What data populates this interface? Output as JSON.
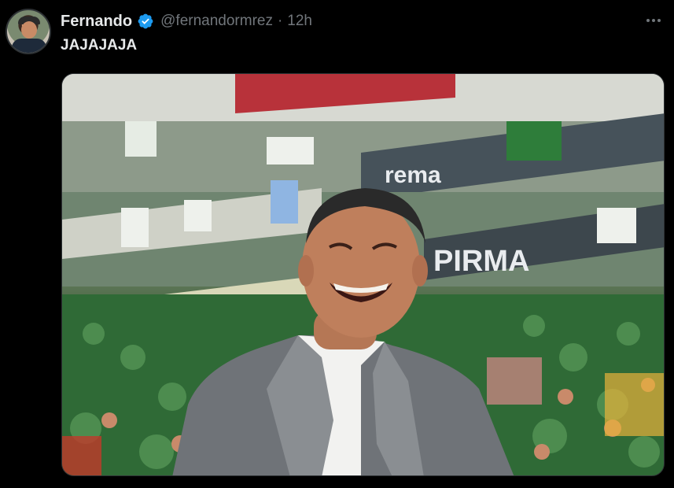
{
  "tweet": {
    "display_name": "Fernando",
    "handle": "@fernandormrez",
    "separator": "·",
    "time": "12h",
    "text": "JAJAJAJA"
  },
  "media": {
    "banner_texts": [
      "PIRMA",
      "rema"
    ]
  },
  "icons": {
    "verified": "verified-badge-icon",
    "more": "more-options-icon"
  },
  "colors": {
    "background": "#000000",
    "verified": "#1d9bf0",
    "secondary_text": "#71767b"
  }
}
